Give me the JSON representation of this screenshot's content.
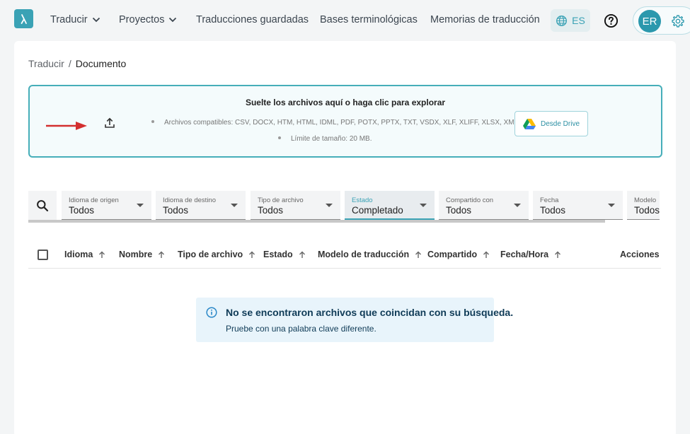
{
  "nav": {
    "items": [
      {
        "label": "Traducir",
        "dropdown": true
      },
      {
        "label": "Proyectos",
        "dropdown": true
      },
      {
        "label": "Traducciones guardadas",
        "dropdown": false
      },
      {
        "label": "Bases terminológicas",
        "dropdown": false
      },
      {
        "label": "Memorias de traducción",
        "dropdown": false
      }
    ],
    "language": "ES",
    "user_initials": "ER",
    "icons": [
      "logo-lambda-icon",
      "chevron-down-icon",
      "globe-icon",
      "help-icon",
      "gear-icon"
    ],
    "accent_color": "#3aa2b5"
  },
  "breadcrumb": {
    "root": "Traducir",
    "separator": "/",
    "current": "Documento"
  },
  "dropzone": {
    "title": "Suelte los archivos aquí o haga clic para explorar",
    "formats": "Archivos compatibles: CSV, DOCX, HTM, HTML, IDML, PDF, POTX, PPTX, TXT, VSDX, XLF, XLIFF, XLSX, XML",
    "size_limit": "Límite de tamaño: 20 MB.",
    "drive_button": "Desde Drive",
    "annotation_color": "#d32f2f"
  },
  "filters": [
    {
      "label": "Idioma de origen",
      "value": "Todos"
    },
    {
      "label": "Idioma de destino",
      "value": "Todos"
    },
    {
      "label": "Tipo de archivo",
      "value": "Todos"
    },
    {
      "label": "Estado",
      "value": "Completado"
    },
    {
      "label": "Compartido con",
      "value": "Todos"
    },
    {
      "label": "Fecha",
      "value": "Todos"
    },
    {
      "label": "Modelo",
      "value": "Todos"
    }
  ],
  "table": {
    "columns": [
      "Idioma",
      "Nombre",
      "Tipo de archivo",
      "Estado",
      "Modelo de traducción",
      "Compartido",
      "Fecha/Hora",
      "Acciones"
    ]
  },
  "empty_state": {
    "title": "No se encontraron archivos que coincidan con su búsqueda.",
    "subtitle": "Pruebe con una palabra clave diferente."
  }
}
